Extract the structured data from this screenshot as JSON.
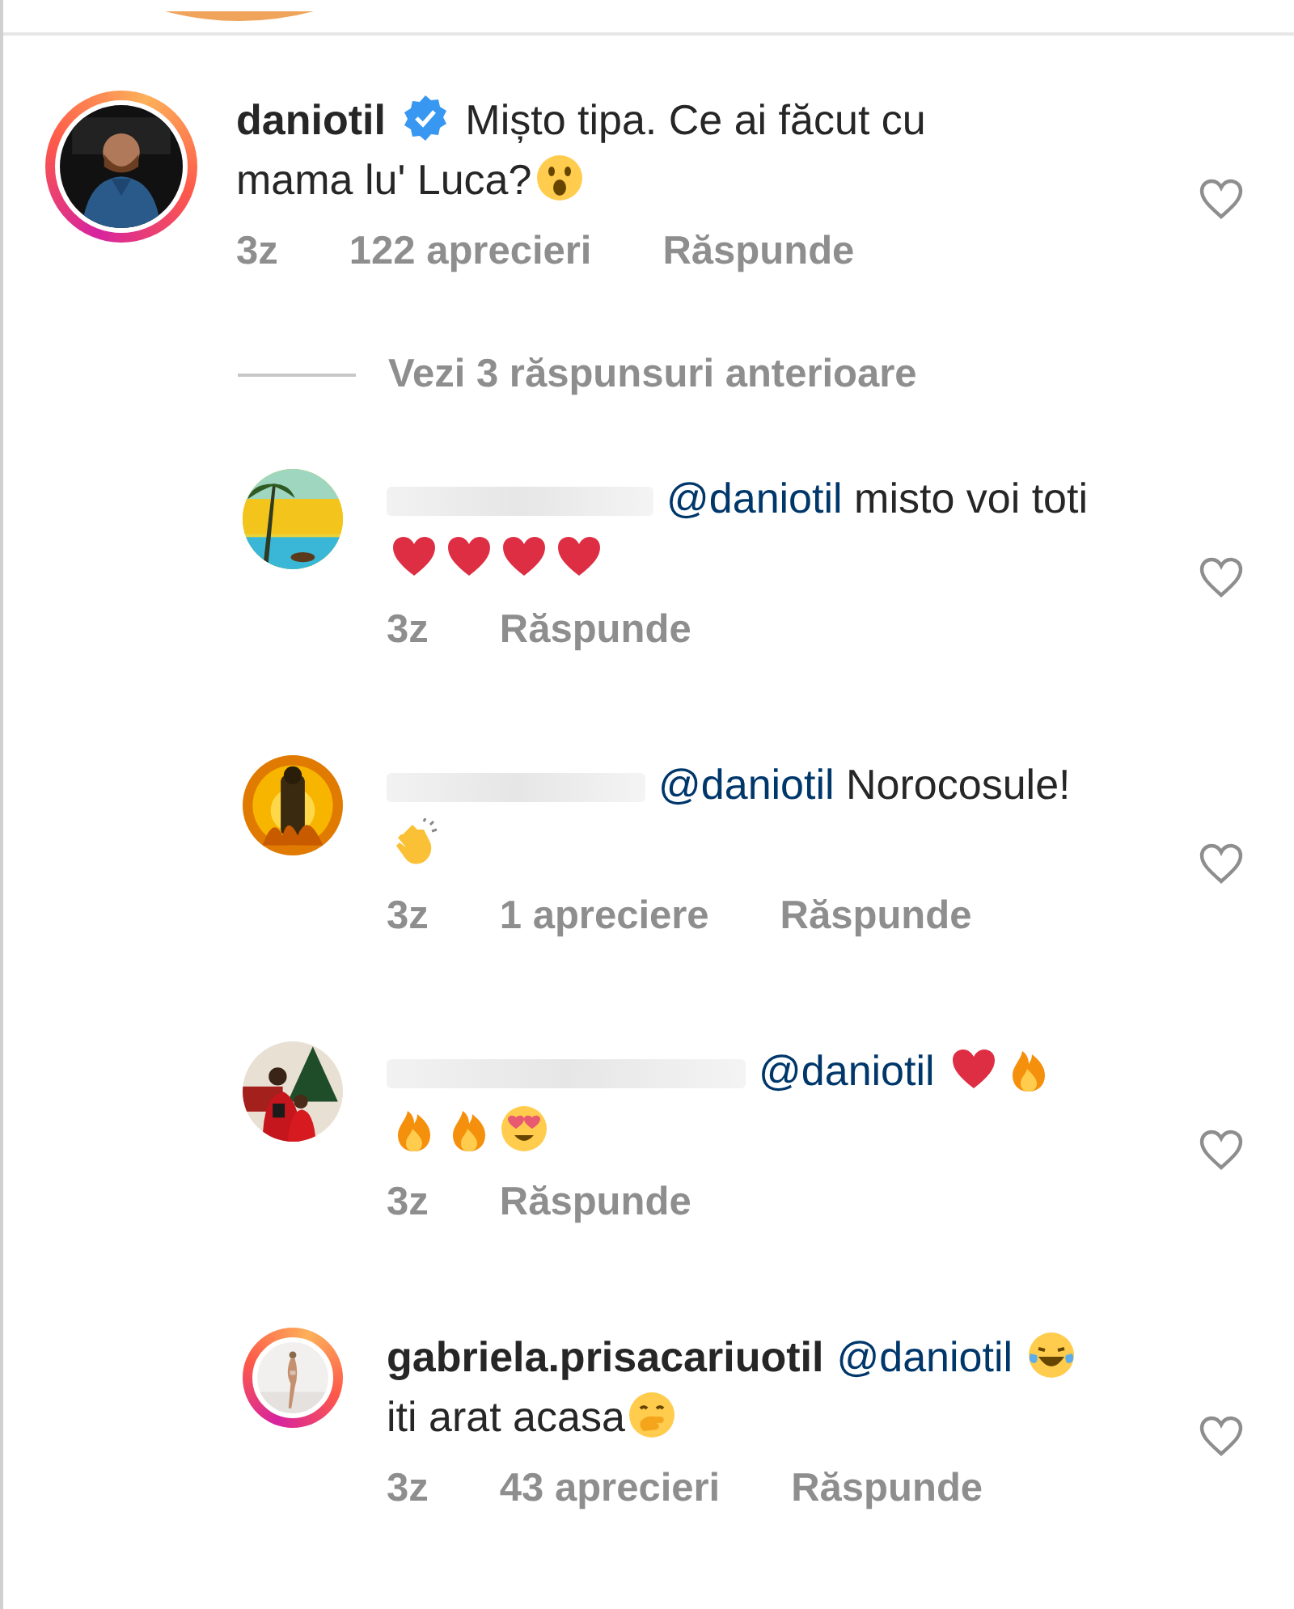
{
  "comment": {
    "username": "daniotil",
    "verified": true,
    "ring": true,
    "liked": false,
    "parts": [
      {
        "kind": "text",
        "text": "Mișto tipa. Ce ai făcut cu mama lu' Luca?"
      },
      {
        "kind": "wow"
      }
    ],
    "meta": [
      "3z",
      "122 aprecieri",
      "Răspunde"
    ]
  },
  "view_previous": "Vezi 3 răspunsuri anterioare",
  "replies": [
    {
      "hidden": true,
      "ring": false,
      "liked": false,
      "parts": [
        {
          "kind": "mention",
          "text": "@daniotil"
        },
        {
          "kind": "text",
          "text": "misto voi toti"
        },
        {
          "kind": "heart"
        },
        {
          "kind": "heart"
        },
        {
          "kind": "heart"
        },
        {
          "kind": "heart"
        }
      ],
      "meta": [
        "3z",
        "Răspunde"
      ]
    },
    {
      "hidden": true,
      "ring": false,
      "liked": false,
      "parts": [
        {
          "kind": "mention",
          "text": "@daniotil"
        },
        {
          "kind": "text",
          "text": "Norocosule!"
        },
        {
          "kind": "clap"
        }
      ],
      "meta": [
        "3z",
        "1 apreciere",
        "Răspunde"
      ]
    },
    {
      "hidden": true,
      "ring": false,
      "liked": false,
      "parts": [
        {
          "kind": "mention",
          "text": "@daniotil"
        },
        {
          "kind": "heart"
        },
        {
          "kind": "fire"
        },
        {
          "kind": "fire"
        },
        {
          "kind": "fire"
        },
        {
          "kind": "hearteyes"
        }
      ],
      "meta": [
        "3z",
        "Răspunde"
      ]
    },
    {
      "hidden": false,
      "username": "gabriela.prisacariuotil",
      "ring": true,
      "liked": false,
      "parts": [
        {
          "kind": "mention",
          "text": "@daniotil"
        },
        {
          "kind": "laugh"
        },
        {
          "kind": "text",
          "text": "iti arat acasa"
        },
        {
          "kind": "giggle"
        }
      ],
      "meta": [
        "3z",
        "43 aprecieri",
        "Răspunde"
      ]
    }
  ]
}
